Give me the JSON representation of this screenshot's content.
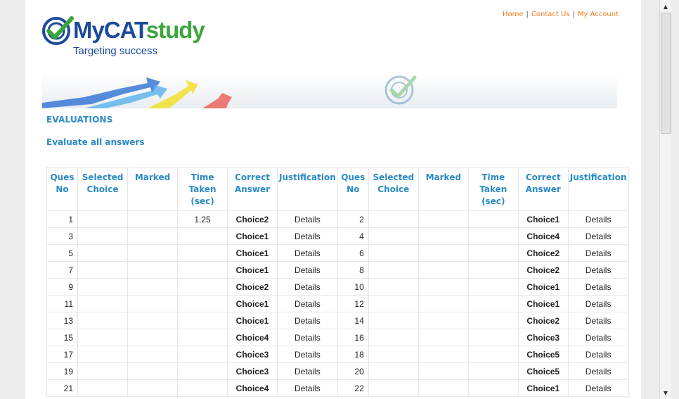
{
  "toplinks": [
    {
      "label": "Home"
    },
    {
      "label": "Contact Us"
    },
    {
      "label": "My Account"
    }
  ],
  "logo": {
    "brand_blue": "MyCAT",
    "brand_green": "study",
    "tagline": "Targeting success"
  },
  "page": {
    "heading": "EVALUATIONS",
    "sublink": "Evaluate all answers"
  },
  "table": {
    "headers": [
      "Ques No",
      "Selected Choice",
      "Marked",
      "Time Taken (sec)",
      "Correct Answer",
      "Justification",
      "Ques No",
      "Selected Choice",
      "Marked",
      "Time Taken (sec)",
      "Correct Answer",
      "Justification"
    ],
    "rows": [
      {
        "q1": "1",
        "time1": "1.25",
        "ans1": "Choice2",
        "det1": "Details",
        "q2": "2",
        "ans2": "Choice1",
        "det2": "Details"
      },
      {
        "q1": "3",
        "time1": "",
        "ans1": "Choice1",
        "det1": "Details",
        "q2": "4",
        "ans2": "Choice4",
        "det2": "Details"
      },
      {
        "q1": "5",
        "time1": "",
        "ans1": "Choice1",
        "det1": "Details",
        "q2": "6",
        "ans2": "Choice2",
        "det2": "Details"
      },
      {
        "q1": "7",
        "time1": "",
        "ans1": "Choice1",
        "det1": "Details",
        "q2": "8",
        "ans2": "Choice2",
        "det2": "Details"
      },
      {
        "q1": "9",
        "time1": "",
        "ans1": "Choice2",
        "det1": "Details",
        "q2": "10",
        "ans2": "Choice1",
        "det2": "Details"
      },
      {
        "q1": "11",
        "time1": "",
        "ans1": "Choice1",
        "det1": "Details",
        "q2": "12",
        "ans2": "Choice1",
        "det2": "Details"
      },
      {
        "q1": "13",
        "time1": "",
        "ans1": "Choice1",
        "det1": "Details",
        "q2": "14",
        "ans2": "Choice2",
        "det2": "Details"
      },
      {
        "q1": "15",
        "time1": "",
        "ans1": "Choice4",
        "det1": "Details",
        "q2": "16",
        "ans2": "Choice3",
        "det2": "Details"
      },
      {
        "q1": "17",
        "time1": "",
        "ans1": "Choice3",
        "det1": "Details",
        "q2": "18",
        "ans2": "Choice5",
        "det2": "Details"
      },
      {
        "q1": "19",
        "time1": "",
        "ans1": "Choice3",
        "det1": "Details",
        "q2": "20",
        "ans2": "Choice5",
        "det2": "Details"
      },
      {
        "q1": "21",
        "time1": "",
        "ans1": "Choice4",
        "det1": "Details",
        "q2": "22",
        "ans2": "Choice1",
        "det2": "Details"
      }
    ]
  },
  "icons": {
    "scroll_up": "scroll-up-arrow-icon",
    "scroll_down": "scroll-down-arrow-icon",
    "logo_mark": "check-target-icon"
  },
  "colors": {
    "accent": "#2a8ac7",
    "link_orange": "#f07a1a",
    "brand_blue": "#1b4a9c",
    "brand_green": "#3aa63a"
  }
}
